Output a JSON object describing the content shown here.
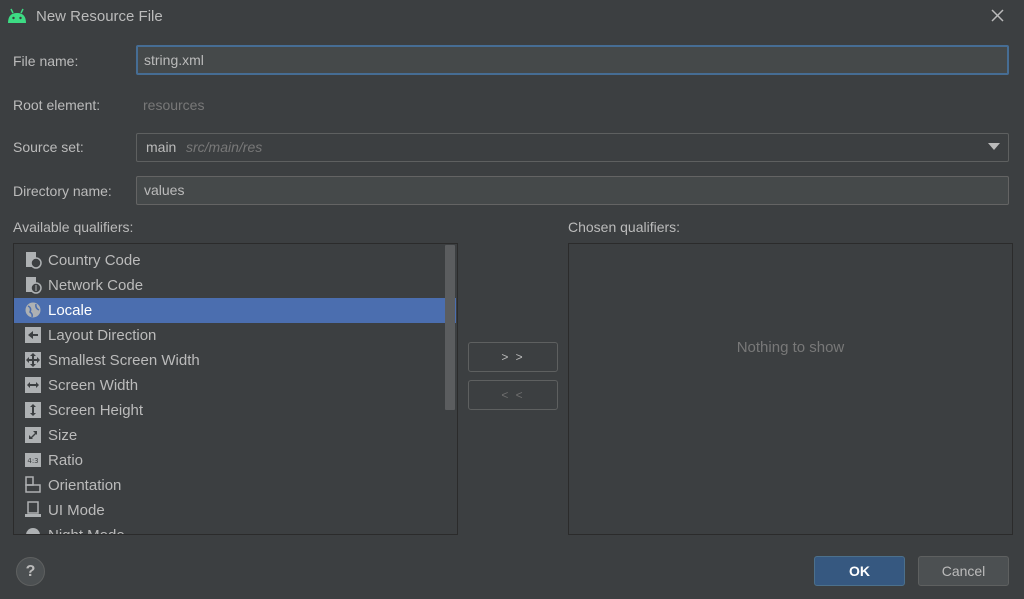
{
  "window": {
    "title": "New Resource File"
  },
  "form": {
    "file_name_label": "File name:",
    "file_name_value": "string.xml",
    "root_element_label": "Root element:",
    "root_element_value": "resources",
    "source_set_label": "Source set:",
    "source_set_value": "main",
    "source_set_path": "src/main/res",
    "directory_label": "Directory name:",
    "directory_value": "values"
  },
  "available": {
    "label": "Available qualifiers:",
    "items": [
      {
        "label": "Country Code",
        "icon": "country-code-icon"
      },
      {
        "label": "Network Code",
        "icon": "network-code-icon"
      },
      {
        "label": "Locale",
        "icon": "globe-icon",
        "selected": true
      },
      {
        "label": "Layout Direction",
        "icon": "layout-direction-icon"
      },
      {
        "label": "Smallest Screen Width",
        "icon": "move-arrows-icon"
      },
      {
        "label": "Screen Width",
        "icon": "horizontal-arrows-icon"
      },
      {
        "label": "Screen Height",
        "icon": "vertical-arrows-icon"
      },
      {
        "label": "Size",
        "icon": "diagonal-resize-icon"
      },
      {
        "label": "Ratio",
        "icon": "ratio-icon"
      },
      {
        "label": "Orientation",
        "icon": "orientation-icon"
      },
      {
        "label": "UI Mode",
        "icon": "ui-mode-icon"
      },
      {
        "label": "Night Mode",
        "icon": "night-mode-icon"
      }
    ]
  },
  "buttons": {
    "add": "> >",
    "remove": "< <",
    "ok": "OK",
    "cancel": "Cancel",
    "help": "?"
  },
  "chosen": {
    "label": "Chosen qualifiers:",
    "empty_text": "Nothing to show"
  },
  "colors": {
    "background": "#3c3f41",
    "selection": "#4b6eaf",
    "ok_button": "#365880",
    "focus_border": "#466d94"
  }
}
